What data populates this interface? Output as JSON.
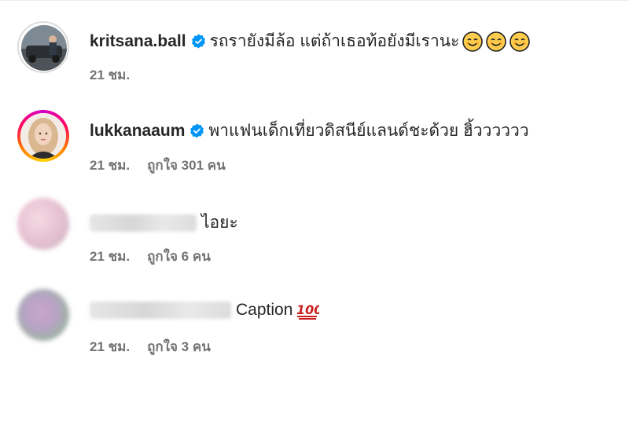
{
  "comments": [
    {
      "username": "kritsana.ball",
      "verified": true,
      "text": "รถรายังมีล้อ แต่ถ้าเธอท้อยังมีเรานะ",
      "emojis": [
        "smiling-face-icon",
        "smiling-face-icon",
        "smiling-face-icon"
      ],
      "time": "21 ชม.",
      "likes": ""
    },
    {
      "username": "lukkanaaum",
      "verified": true,
      "text": "พาแฟนเด็กเที่ยวดิสนีย์แลนด์ชะด้วย ฮิ้วววววว",
      "time": "21 ชม.",
      "likes": "ถูกใจ 301 คน"
    },
    {
      "username_hidden": true,
      "text": "ไอยะ",
      "time": "21 ชม.",
      "likes": "ถูกใจ 6 คน"
    },
    {
      "username_hidden": true,
      "text": "Caption",
      "emojis": [
        "hundred-points-icon"
      ],
      "time": "21 ชม.",
      "likes": "ถูกใจ 3 คน"
    }
  ],
  "colors": {
    "verified_blue": "#0095f6",
    "text": "#262626",
    "meta": "#737373"
  }
}
